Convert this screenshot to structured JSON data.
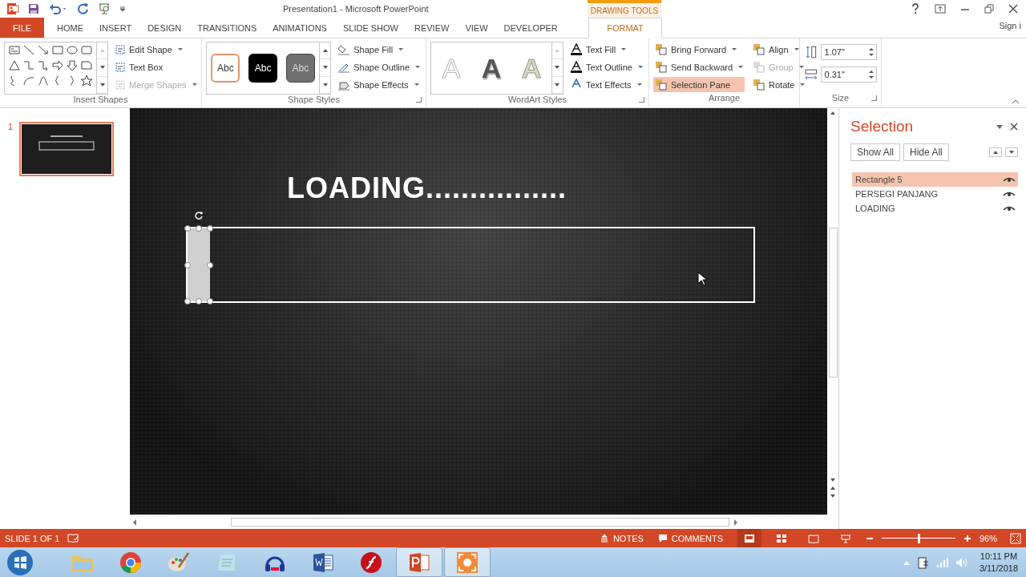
{
  "title_bar": {
    "title": "Presentation1 - Microsoft PowerPoint",
    "context_tab": "DRAWING TOOLS",
    "sign_in": "Sign i"
  },
  "tabs": [
    {
      "label": "FILE",
      "kind": "file",
      "selected": false
    },
    {
      "label": "HOME",
      "kind": "normal",
      "selected": false
    },
    {
      "label": "INSERT",
      "kind": "normal",
      "selected": false
    },
    {
      "label": "DESIGN",
      "kind": "normal",
      "selected": false
    },
    {
      "label": "TRANSITIONS",
      "kind": "normal",
      "selected": false
    },
    {
      "label": "ANIMATIONS",
      "kind": "normal",
      "selected": false
    },
    {
      "label": "SLIDE SHOW",
      "kind": "normal",
      "selected": false
    },
    {
      "label": "REVIEW",
      "kind": "normal",
      "selected": false
    },
    {
      "label": "VIEW",
      "kind": "normal",
      "selected": false
    },
    {
      "label": "DEVELOPER",
      "kind": "normal",
      "selected": false
    },
    {
      "label": "FORMAT",
      "kind": "contextual",
      "selected": true
    }
  ],
  "ribbon": {
    "insert_shapes": {
      "label": "Insert Shapes",
      "commands": [
        {
          "label": "Edit Shape",
          "dropdown": true,
          "disabled": false
        },
        {
          "label": "Text Box",
          "dropdown": false,
          "disabled": false
        },
        {
          "label": "Merge Shapes",
          "dropdown": true,
          "disabled": true
        }
      ]
    },
    "shape_styles": {
      "label": "Shape Styles",
      "presets": [
        {
          "label": "Abc",
          "kind": "outline"
        },
        {
          "label": "Abc",
          "kind": "black"
        },
        {
          "label": "Abc",
          "kind": "grey"
        }
      ],
      "commands": [
        {
          "label": "Shape Fill",
          "dropdown": true,
          "disabled": false
        },
        {
          "label": "Shape Outline",
          "dropdown": true,
          "disabled": false
        },
        {
          "label": "Shape Effects",
          "dropdown": true,
          "disabled": false
        }
      ]
    },
    "wordart_styles": {
      "label": "WordArt Styles",
      "presets": [
        {
          "label": "A",
          "kind": "outline"
        },
        {
          "label": "A",
          "kind": "shadow"
        },
        {
          "label": "A",
          "kind": "glow"
        }
      ],
      "commands": [
        {
          "label": "Text Fill",
          "dropdown": true,
          "disabled": false
        },
        {
          "label": "Text Outline",
          "dropdown": true,
          "disabled": false
        },
        {
          "label": "Text Effects",
          "dropdown": true,
          "disabled": false
        }
      ]
    },
    "arrange": {
      "label": "Arrange",
      "commands": [
        {
          "label": "Bring Forward",
          "dropdown": true,
          "disabled": false,
          "selected": false
        },
        {
          "label": "Align",
          "dropdown": true,
          "disabled": false,
          "selected": false
        },
        {
          "label": "Send Backward",
          "dropdown": true,
          "disabled": false,
          "selected": false
        },
        {
          "label": "Group",
          "dropdown": true,
          "disabled": true,
          "selected": false
        },
        {
          "label": "Selection Pane",
          "dropdown": false,
          "disabled": false,
          "selected": true
        },
        {
          "label": "Rotate",
          "dropdown": true,
          "disabled": false,
          "selected": false
        }
      ]
    },
    "size": {
      "label": "Size",
      "height": "1.07\"",
      "width": "0.31\""
    }
  },
  "slides": [
    {
      "number": "1",
      "selected": true
    }
  ],
  "slide": {
    "title": "LOADING................",
    "progress_bar": {
      "level": 0.04
    }
  },
  "selection_pane": {
    "title": "Selection",
    "buttons": [
      "Show All",
      "Hide All"
    ],
    "items": [
      {
        "label": "Rectangle 5",
        "selected": true,
        "visible": true
      },
      {
        "label": "PERSEGI PANJANG",
        "selected": false,
        "visible": true
      },
      {
        "label": "LOADING",
        "selected": false,
        "visible": true
      }
    ]
  },
  "status_bar": {
    "slide_count": "SLIDE 1 OF 1",
    "notes": "NOTES",
    "comments": "COMMENTS",
    "views": [
      {
        "kind": "normal",
        "selected": true
      },
      {
        "kind": "sorter",
        "selected": false
      },
      {
        "kind": "reading",
        "selected": false
      },
      {
        "kind": "slideshow",
        "selected": false
      }
    ],
    "zoom": {
      "level": 0.5,
      "reading": "96%"
    }
  },
  "taskbar": {
    "apps": [
      {
        "kind": "explorer",
        "active": false
      },
      {
        "kind": "chrome",
        "active": false
      },
      {
        "kind": "paint",
        "active": false
      },
      {
        "kind": "notepad",
        "active": false
      },
      {
        "kind": "audio",
        "active": false
      },
      {
        "kind": "word",
        "active": false
      },
      {
        "kind": "flash",
        "active": false
      },
      {
        "kind": "powerpoint",
        "active": true
      },
      {
        "kind": "recorder",
        "active": true
      }
    ],
    "time": "10:11 PM",
    "date": "3/11/2018"
  }
}
